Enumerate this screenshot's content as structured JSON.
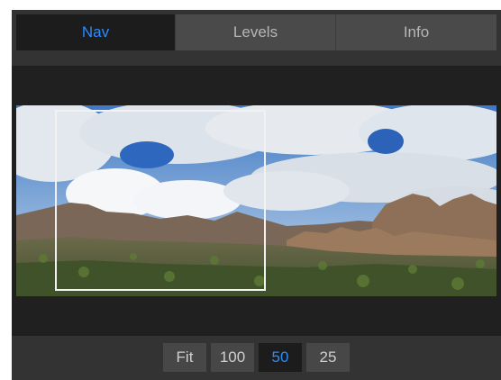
{
  "tabs": [
    {
      "label": "Nav",
      "active": true
    },
    {
      "label": "Levels",
      "active": false
    },
    {
      "label": "Info",
      "active": false
    }
  ],
  "navigator": {
    "image": "desert-rocks-landscape"
  },
  "zoom": {
    "options": [
      "Fit",
      "100",
      "50",
      "25"
    ],
    "selected": "50"
  },
  "colors": {
    "accent": "#2a8dff",
    "panel": "#333333",
    "active_bg": "#1c1c1c"
  }
}
